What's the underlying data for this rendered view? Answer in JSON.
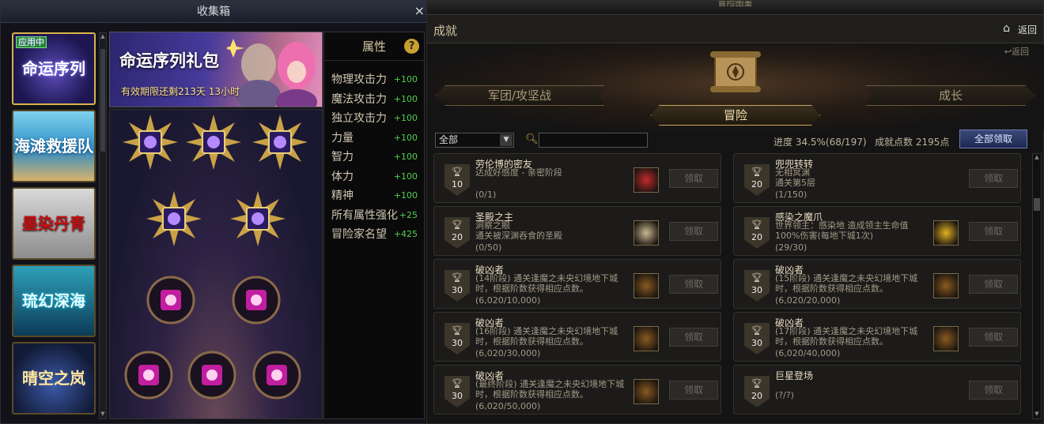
{
  "collection": {
    "title": "收集箱",
    "close": "×",
    "themes": [
      {
        "label": "命运序列",
        "tag": "应用中"
      },
      {
        "label": "海滩救援队",
        "tag": ""
      },
      {
        "label": "墨染丹青",
        "tag": ""
      },
      {
        "label": "琉幻深海",
        "tag": ""
      },
      {
        "label": "晴空之岚",
        "tag": ""
      }
    ],
    "banner": {
      "title": "命运序列礼包",
      "subtitle": "有效期限还剩213天 13小时"
    },
    "properties": {
      "header": "属性",
      "help": "?",
      "rows": [
        {
          "name": "物理攻击力",
          "value": "+100"
        },
        {
          "name": "魔法攻击力",
          "value": "+100"
        },
        {
          "name": "独立攻击力",
          "value": "+100"
        },
        {
          "name": "力量",
          "value": "+100"
        },
        {
          "name": "智力",
          "value": "+100"
        },
        {
          "name": "体力",
          "value": "+100"
        },
        {
          "name": "精神",
          "value": "+100"
        },
        {
          "name": "所有属性强化",
          "value": "+25"
        },
        {
          "name": "冒险家名望",
          "value": "+425"
        }
      ]
    }
  },
  "adventure": {
    "window_title": "冒险图鉴",
    "section_title": "成就",
    "back": "返回",
    "sub_back": "返回",
    "tabs": {
      "left": "军团/攻坚战",
      "center": "冒险",
      "right": "成长"
    },
    "filter": {
      "selected": "全部"
    },
    "progress": "进度  34.5%(68/197)",
    "points": "成就点数 2195点",
    "claim_all": "全部领取",
    "claim_label": "领取",
    "achievements": [
      {
        "points": "10",
        "name": "劳伦博的密友",
        "desc": "达成好感度 - 亲密阶段",
        "progress": "(0/1)",
        "reward_color": "#c42a2a"
      },
      {
        "points": "20",
        "name": "兜兜转转",
        "desc": "无相冥渊\n通关第5层",
        "progress": "(1/150)",
        "reward_color": ""
      },
      {
        "points": "20",
        "name": "圣殿之主",
        "desc": "洞察之眼\n通关被深渊吞食的圣殿",
        "progress": "(0/50)",
        "reward_color": "#c8b890"
      },
      {
        "points": "20",
        "name": "感染之魔爪",
        "desc": "世界领主：感染地       造成领主生命值100%伤害(每地下城1次)",
        "progress": "(29/30)",
        "reward_color": "#e0b020"
      },
      {
        "points": "30",
        "name": "破凶者",
        "desc": "(14阶段) 通关逢魔之未央幻境地下城时，根据阶数获得相应点数。",
        "progress": "(6,020/10,000)",
        "reward_color": "#8a5a20"
      },
      {
        "points": "30",
        "name": "破凶者",
        "desc": "(15阶段) 通关逢魔之未央幻境地下城时，根据阶数获得相应点数。",
        "progress": "(6,020/20,000)",
        "reward_color": "#8a5a20"
      },
      {
        "points": "30",
        "name": "破凶者",
        "desc": "(16阶段) 通关逢魔之未央幻境地下城时，根据阶数获得相应点数。",
        "progress": "(6,020/30,000)",
        "reward_color": "#8a5a20"
      },
      {
        "points": "30",
        "name": "破凶者",
        "desc": "(17阶段) 通关逢魔之未央幻境地下城时，根据阶数获得相应点数。",
        "progress": "(6,020/40,000)",
        "reward_color": "#8a5a20"
      },
      {
        "points": "30",
        "name": "破凶者",
        "desc": "(最终阶段) 通关逢魔之未央幻境地下城时，根据阶数获得相应点数。",
        "progress": "(6,020/50,000)",
        "reward_color": "#8a5a20"
      },
      {
        "points": "20",
        "name": "巨星登场",
        "desc": "",
        "progress": "(?/?)",
        "reward_color": ""
      }
    ]
  }
}
